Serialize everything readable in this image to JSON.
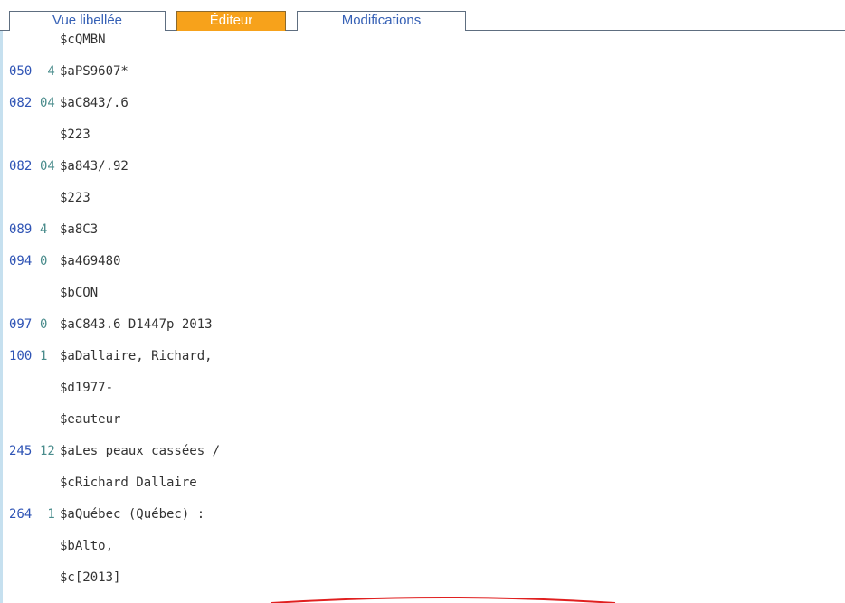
{
  "tabs": [
    {
      "label": "Vue libellée",
      "active": false
    },
    {
      "label": "Éditeur",
      "active": true
    },
    {
      "label": "Modifications",
      "active": false
    }
  ],
  "colors": {
    "tag": "#2f54b5",
    "indicator": "#4a8c8c",
    "value": "#333333",
    "active_tab_bg": "#f7a21b",
    "tab_text": "#3560b5",
    "annotation": "#e02020"
  },
  "rows": [
    {
      "tag": "",
      "ind": "",
      "val": "$cQMBN"
    },
    {
      "tag": "050",
      "ind": " 4",
      "val": "$aPS9607*"
    },
    {
      "tag": "082",
      "ind": "04",
      "val": "$aC843/.6"
    },
    {
      "tag": "",
      "ind": "",
      "val": "$223"
    },
    {
      "tag": "082",
      "ind": "04",
      "val": "$a843/.92"
    },
    {
      "tag": "",
      "ind": "",
      "val": "$223"
    },
    {
      "tag": "089",
      "ind": "4",
      "val": "$a8C3"
    },
    {
      "tag": "094",
      "ind": "0",
      "val": "$a469480"
    },
    {
      "tag": "",
      "ind": "",
      "val": "$bCON"
    },
    {
      "tag": "097",
      "ind": "0",
      "val": "$aC843.6 D1447p 2013"
    },
    {
      "tag": "100",
      "ind": "1",
      "val": "$aDallaire, Richard,"
    },
    {
      "tag": "",
      "ind": "",
      "val": "$d1977-"
    },
    {
      "tag": "",
      "ind": "",
      "val": "$eauteur"
    },
    {
      "tag": "245",
      "ind": "12",
      "val": "$aLes peaux cassées /"
    },
    {
      "tag": "",
      "ind": "",
      "val": "$cRichard Dallaire"
    },
    {
      "tag": "264",
      "ind": " 1",
      "val": "$aQuébec (Québec) :"
    },
    {
      "tag": "",
      "ind": "",
      "val": "$bAlto,"
    },
    {
      "tag": "",
      "ind": "",
      "val": "$c[2013]"
    }
  ]
}
